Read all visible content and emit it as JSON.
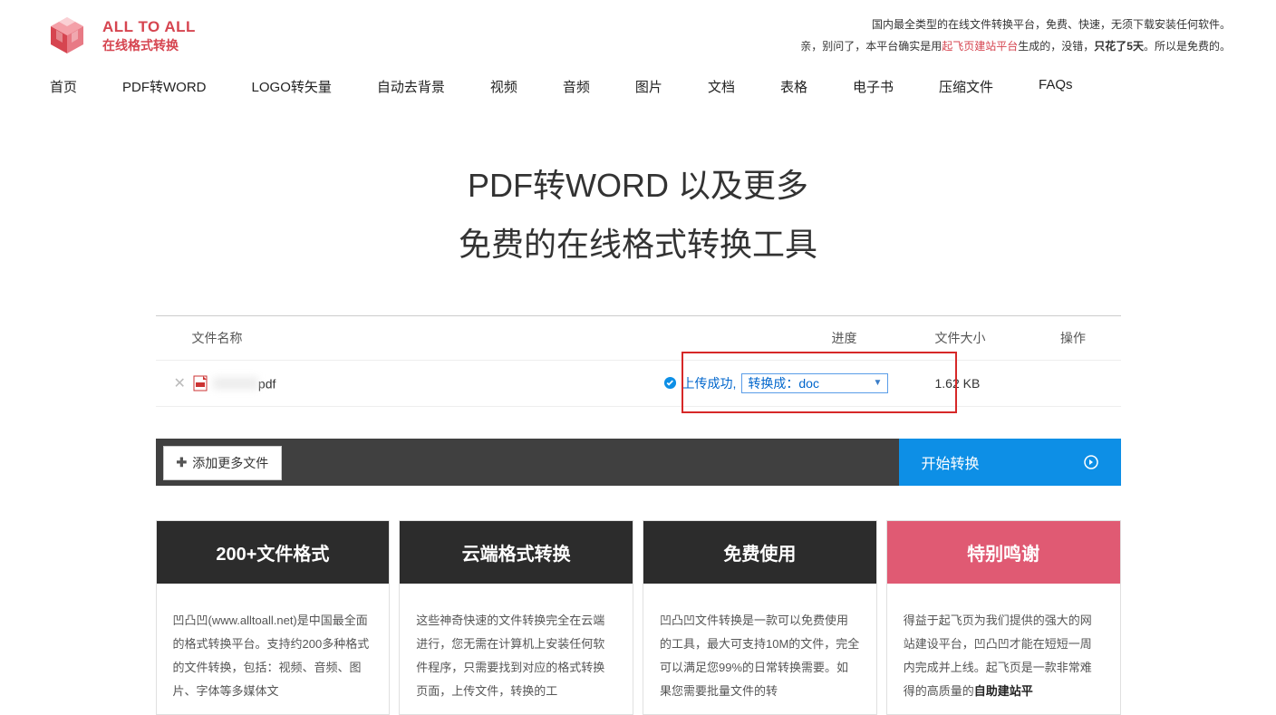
{
  "header": {
    "logo_line1": "ALL TO ALL",
    "logo_line2": "在线格式转换",
    "note1": "国内最全类型的在线文件转换平台，免费、快速，无须下载安装任何软件。",
    "note2_pre": "亲，别问了，本平台确实是用",
    "note2_link": "起飞页建站平台",
    "note2_mid": "生成的，没错，",
    "note2_bold": "只花了5天",
    "note2_post": "。所以是免费的。"
  },
  "nav": [
    "首页",
    "PDF转WORD",
    "LOGO转矢量",
    "自动去背景",
    "视频",
    "音频",
    "图片",
    "文档",
    "表格",
    "电子书",
    "压缩文件",
    "FAQs"
  ],
  "hero": {
    "line1": "PDF转WORD 以及更多",
    "line2": "免费的在线格式转换工具"
  },
  "table": {
    "headers": {
      "name": "文件名称",
      "progress": "进度",
      "size": "文件大小",
      "action": "操作"
    },
    "row": {
      "ext": "pdf",
      "upload_ok": "上传成功,",
      "select_prefix": "转换成：",
      "select_value": "doc",
      "size": "1.62 KB"
    }
  },
  "actions": {
    "add_more": "添加更多文件",
    "start": "开始转换"
  },
  "cards": [
    {
      "title": "200+文件格式",
      "body_pre": "凹凸凹(www.alltoall.net)是中国最全面的格式转换平台。支持约200多种格式的文件转换，包括：视频、音频、图片、字体等多媒体文",
      "emph": "",
      "body_post": ""
    },
    {
      "title": "云端格式转换",
      "body_pre": "这些神奇快速的文件转换完全在云端进行，您无需在计算机上安装任何软件程序，只需要找到对应的格式转换页面，上传文件，转换的工",
      "emph": "",
      "body_post": ""
    },
    {
      "title": "免费使用",
      "body_pre": "凹凸凹文件转换是一款可以免费使用的工具，最大可支持10M的文件，完全可以满足您99%的日常转换需要。如果您需要批量文件的转",
      "emph": "",
      "body_post": ""
    },
    {
      "title": "特别鸣谢",
      "body_pre": "得益于起飞页为我们提供的强大的网站建设平台，凹凸凹才能在短短一周内完成并上线。起飞页是一款非常难得的高质量的",
      "emph": "自助建站平",
      "body_post": ""
    }
  ]
}
